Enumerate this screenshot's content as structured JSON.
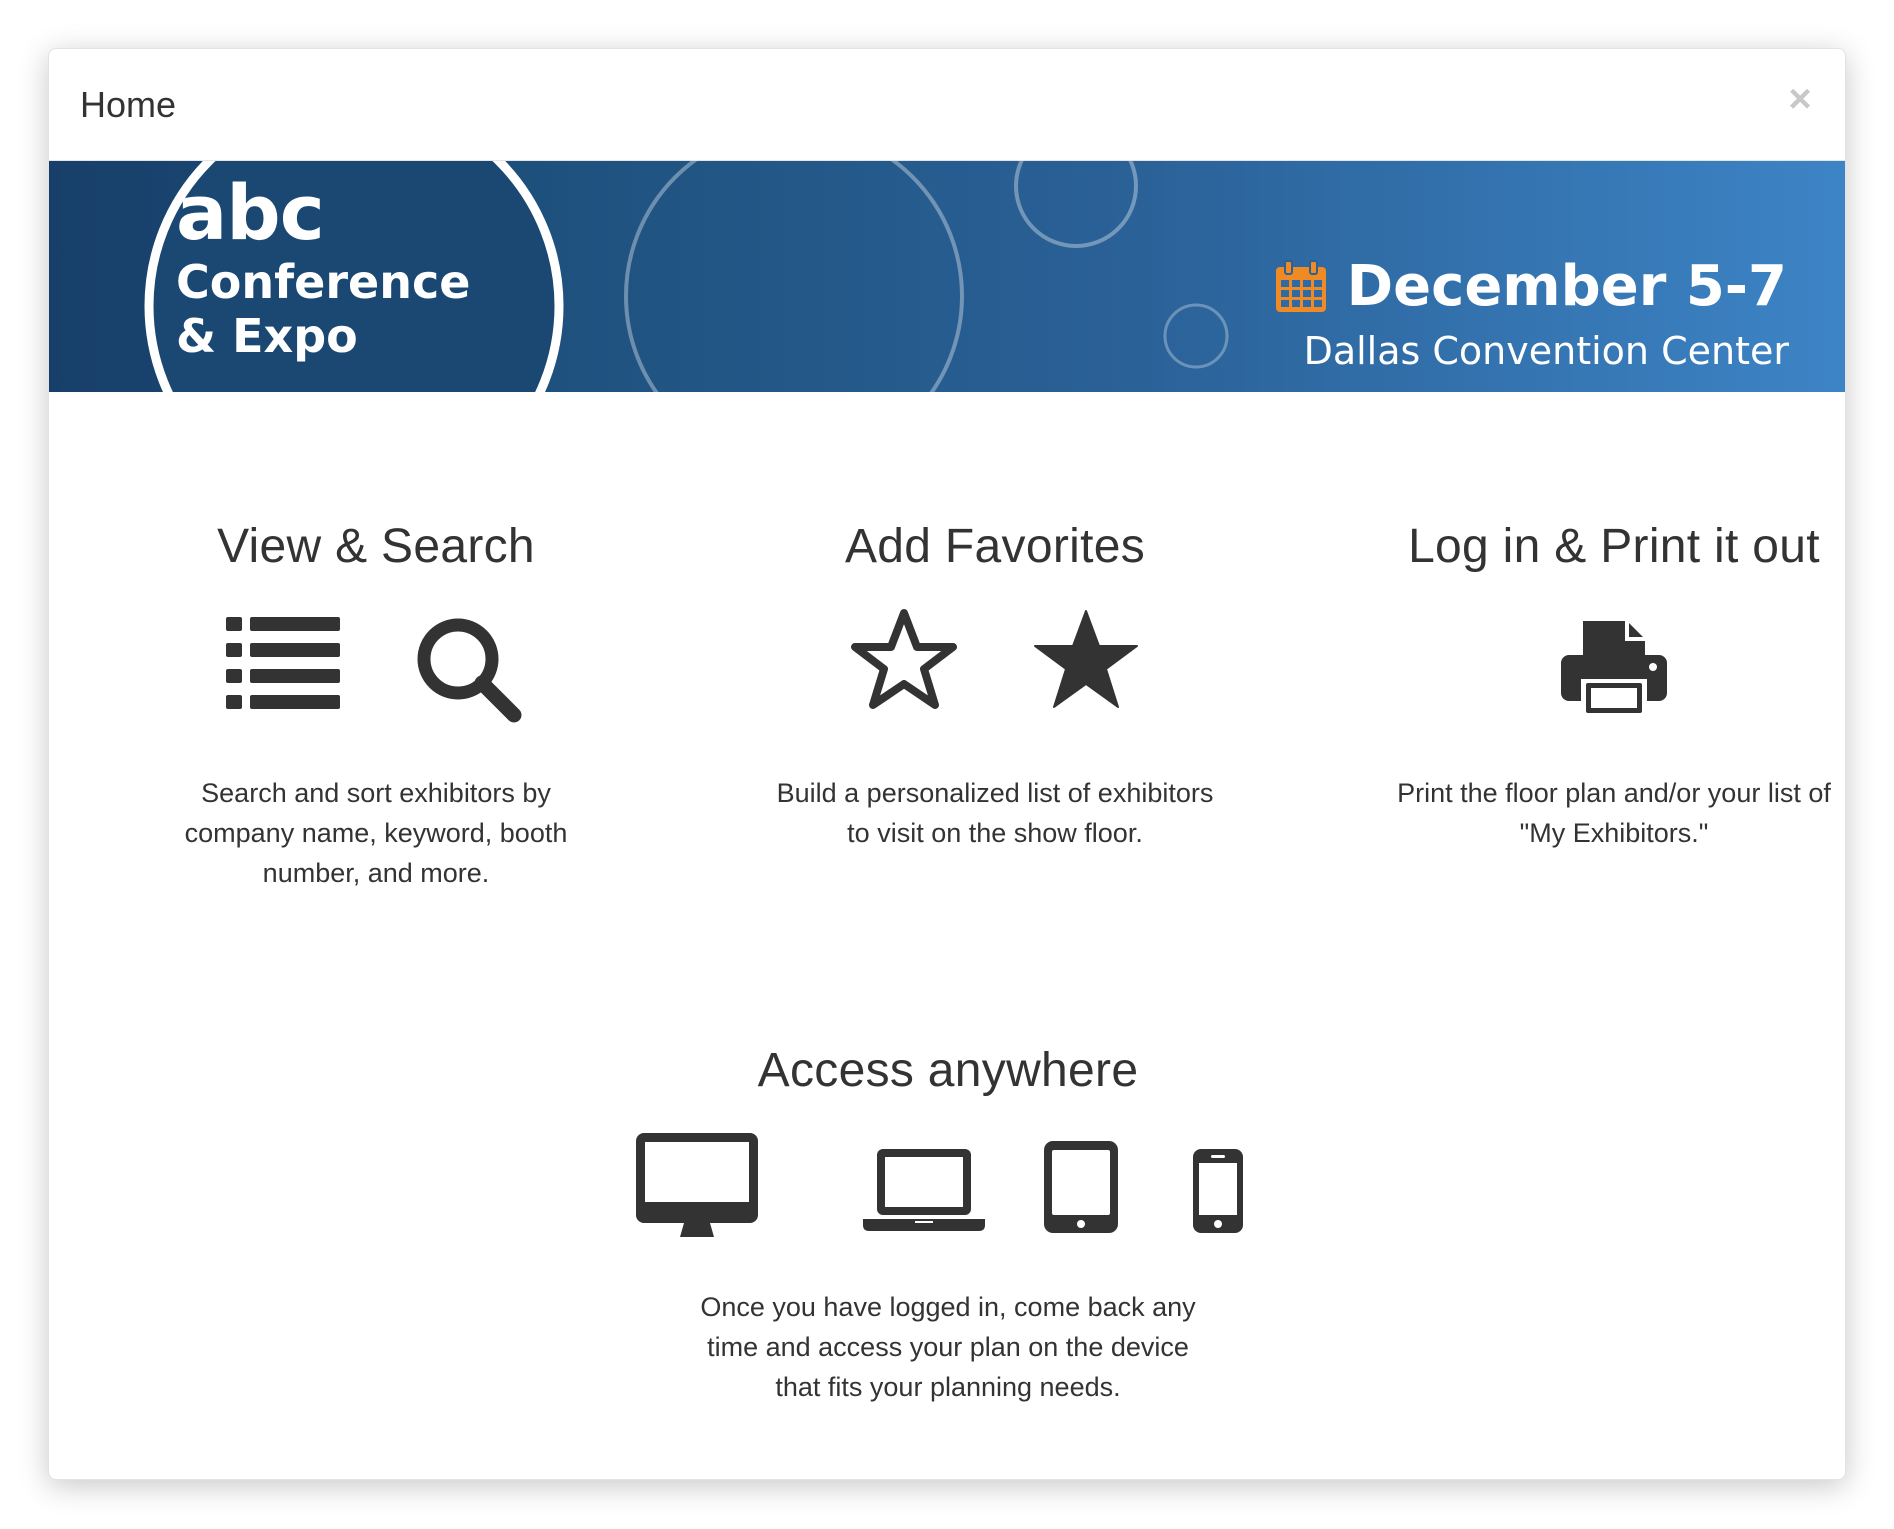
{
  "modal": {
    "title": "Home",
    "close_label": "×"
  },
  "banner": {
    "logo_abc": "abc",
    "logo_line1": "Conference",
    "logo_line2": "& Expo",
    "date": "December 5-7",
    "venue": "Dallas Convention Center",
    "calendar_color": "#f08a24"
  },
  "features": [
    {
      "title": "View & Search",
      "icons": [
        "list-icon",
        "search-icon"
      ],
      "description": "Search and sort exhibitors by company name, keyword, booth number, and more."
    },
    {
      "title": "Add Favorites",
      "icons": [
        "star-outline-icon",
        "star-filled-icon"
      ],
      "description": "Build a personalized list of exhibitors to visit on the show floor."
    },
    {
      "title": "Log in & Print it out",
      "icons": [
        "printer-icon"
      ],
      "description": "Print the floor plan and/or your list of \"My Exhibitors.\""
    },
    {
      "title": "Access anywhere",
      "icons": [
        "desktop-icon",
        "laptop-icon",
        "tablet-icon",
        "phone-icon"
      ],
      "description": "Once you have logged in, come back any time and access your plan on the device that fits your planning needs."
    }
  ],
  "colors": {
    "icon": "#333333",
    "banner_dark": "#173f69",
    "banner_light": "#3d84c6"
  }
}
